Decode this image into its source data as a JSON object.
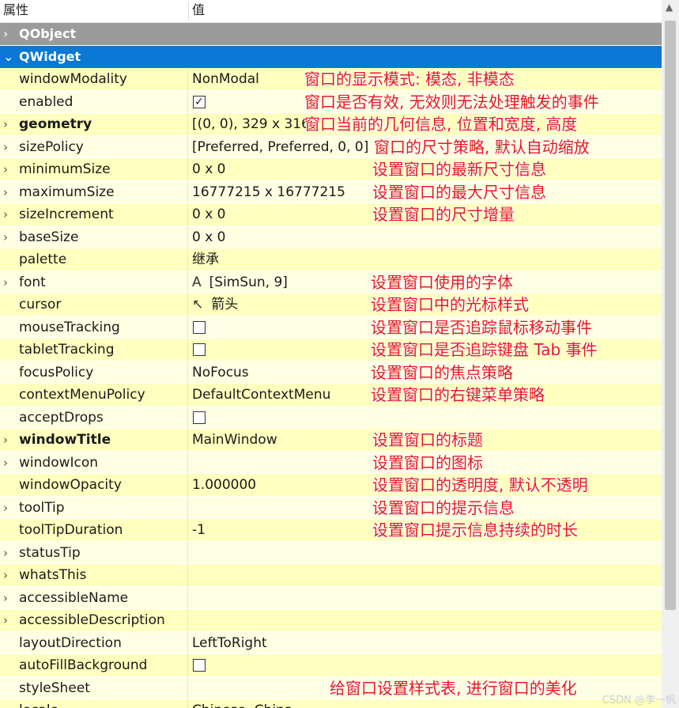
{
  "header": {
    "property": "属性",
    "value": "值"
  },
  "groups": {
    "qobject": "QObject",
    "qwidget": "QWidget"
  },
  "rows": [
    {
      "name": "windowModality",
      "value": "NonModal",
      "note": "窗口的显示模式: 模态, 非模态",
      "expander": false,
      "bold": false
    },
    {
      "name": "enabled",
      "checkbox": true,
      "checked": true,
      "note": "窗口是否有效, 无效则无法处理触发的事件",
      "expander": false,
      "bold": false
    },
    {
      "name": "geometry",
      "value": "[(0, 0), 329 x 316",
      "note": "窗口当前的几何信息, 位置和宽度, 高度",
      "expander": true,
      "bold": true
    },
    {
      "name": "sizePolicy",
      "value": "[Preferred, Preferred, 0, 0]",
      "note": "窗口的尺寸策略, 默认自动缩放",
      "expander": true,
      "bold": false
    },
    {
      "name": "minimumSize",
      "value": "0 x 0",
      "note": "设置窗口的最新尺寸信息",
      "expander": true,
      "bold": false
    },
    {
      "name": "maximumSize",
      "value": "16777215 x 16777215",
      "note": "设置窗口的最大尺寸信息",
      "expander": true,
      "bold": false
    },
    {
      "name": "sizeIncrement",
      "value": "0 x 0",
      "note": "设置窗口的尺寸增量",
      "expander": true,
      "bold": false
    },
    {
      "name": "baseSize",
      "value": "0 x 0",
      "note": "",
      "expander": true,
      "bold": false
    },
    {
      "name": "palette",
      "value": "继承",
      "note": "",
      "expander": false,
      "bold": false
    },
    {
      "name": "font",
      "value": "[SimSun, 9]",
      "icon": "font-icon",
      "iconGlyph": "A",
      "note": "设置窗口使用的字体",
      "expander": true,
      "bold": false
    },
    {
      "name": "cursor",
      "value": "箭头",
      "icon": "arrow-cursor-icon",
      "iconGlyph": "↖",
      "note": "设置窗口中的光标样式",
      "expander": false,
      "bold": false
    },
    {
      "name": "mouseTracking",
      "checkbox": true,
      "checked": false,
      "note": "设置窗口是否追踪鼠标移动事件",
      "expander": false,
      "bold": false
    },
    {
      "name": "tabletTracking",
      "checkbox": true,
      "checked": false,
      "note": "设置窗口是否追踪键盘 Tab 事件",
      "expander": false,
      "bold": false
    },
    {
      "name": "focusPolicy",
      "value": "NoFocus",
      "note": "设置窗口的焦点策略",
      "expander": false,
      "bold": false
    },
    {
      "name": "contextMenuPolicy",
      "value": "DefaultContextMenu",
      "note": "设置窗口的右键菜单策略",
      "expander": false,
      "bold": false
    },
    {
      "name": "acceptDrops",
      "checkbox": true,
      "checked": false,
      "note": "",
      "expander": false,
      "bold": false
    },
    {
      "name": "windowTitle",
      "value": "MainWindow",
      "note": "设置窗口的标题",
      "expander": true,
      "bold": true
    },
    {
      "name": "windowIcon",
      "value": "",
      "note": "设置窗口的图标",
      "expander": true,
      "bold": false
    },
    {
      "name": "windowOpacity",
      "value": "1.000000",
      "note": "设置窗口的透明度, 默认不透明",
      "expander": false,
      "bold": false
    },
    {
      "name": "toolTip",
      "value": "",
      "note": "设置窗口的提示信息",
      "expander": true,
      "bold": false
    },
    {
      "name": "toolTipDuration",
      "value": "-1",
      "note": "设置窗口提示信息持续的时长",
      "expander": false,
      "bold": false
    },
    {
      "name": "statusTip",
      "value": "",
      "note": "",
      "expander": true,
      "bold": false
    },
    {
      "name": "whatsThis",
      "value": "",
      "note": "",
      "expander": true,
      "bold": false
    },
    {
      "name": "accessibleName",
      "value": "",
      "note": "",
      "expander": true,
      "bold": false
    },
    {
      "name": "accessibleDescription",
      "value": "",
      "note": "",
      "expander": true,
      "bold": false
    },
    {
      "name": "layoutDirection",
      "value": "LeftToRight",
      "note": "",
      "expander": false,
      "bold": false
    },
    {
      "name": "autoFillBackground",
      "checkbox": true,
      "checked": false,
      "note": "",
      "expander": false,
      "bold": false
    },
    {
      "name": "styleSheet",
      "value": "",
      "note": "给窗口设置样式表, 进行窗口的美化",
      "expander": false,
      "bold": false
    },
    {
      "name": "locale",
      "value": "Chinese, China",
      "note": "",
      "expander": true,
      "bold": false
    }
  ],
  "corner_watermark": "CSDN @李一帆",
  "colors": {
    "rowOdd": "#ffffbf",
    "rowEven": "#ffffe3",
    "accent": "#0a78d4",
    "note": "#e81919"
  }
}
